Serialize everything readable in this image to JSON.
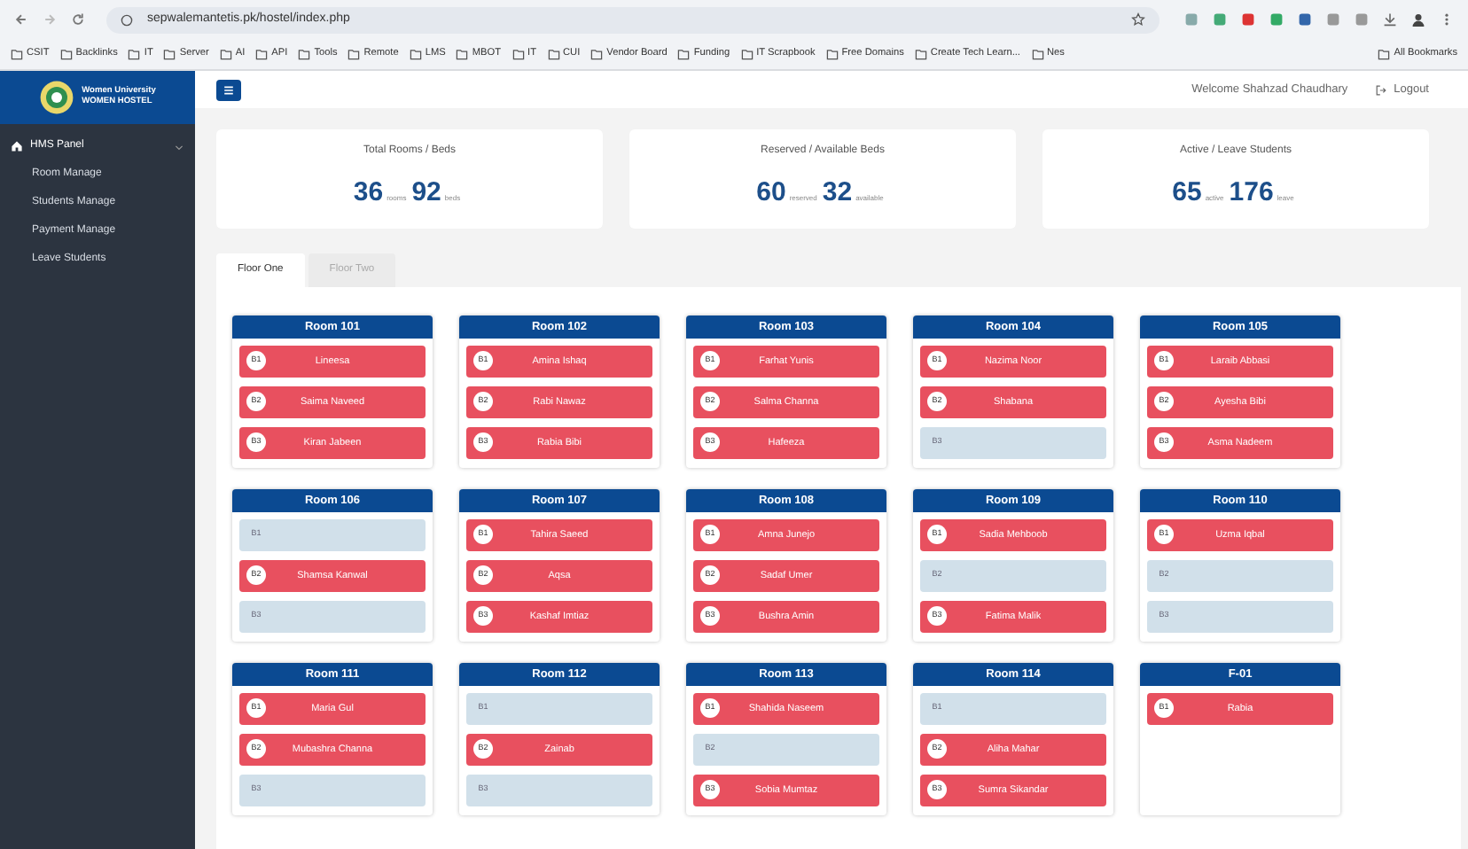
{
  "browser": {
    "url": "sepwalemantetis.pk/hostel/index.php",
    "bookmarks": [
      "CSIT",
      "Backlinks",
      "IT",
      "Server",
      "AI",
      "API",
      "Tools",
      "Remote",
      "LMS",
      "MBOT",
      "IT",
      "CUI",
      "Vendor Board",
      "Funding",
      "IT Scrapbook",
      "Free Domains",
      "Create Tech Learn...",
      "Nes"
    ],
    "all_bookmarks": "All Bookmarks"
  },
  "sidebar": {
    "logo_lines": [
      "Women University",
      "WOMEN HOSTEL"
    ],
    "panel": "HMS Panel",
    "expanded": true,
    "items": [
      "Room Manage",
      "Students Manage",
      "Payment Manage",
      "Leave Students"
    ]
  },
  "header": {
    "welcome": "Welcome Shahzad Chaudhary",
    "logout": "Logout"
  },
  "stats": [
    {
      "title": "Total Rooms / Beds",
      "v1": "36",
      "u1": "rooms",
      "v2": "92",
      "u2": "beds"
    },
    {
      "title": "Reserved / Available Beds",
      "v1": "60",
      "u1": "reserved",
      "v2": "32",
      "u2": "available"
    },
    {
      "title": "Active / Leave Students",
      "v1": "65",
      "u1": "active",
      "v2": "176",
      "u2": "leave"
    }
  ],
  "tabs": [
    {
      "label": "Floor One",
      "selected": true
    },
    {
      "label": "Floor Two",
      "selected": false
    }
  ],
  "rooms": [
    {
      "title": "Room 101",
      "beds": [
        {
          "number": "B1",
          "occupied": true,
          "student": "Lineesa"
        },
        {
          "number": "B2",
          "occupied": true,
          "student": "Saima Naveed"
        },
        {
          "number": "B3",
          "occupied": true,
          "student": "Kiran Jabeen"
        }
      ]
    },
    {
      "title": "Room 102",
      "beds": [
        {
          "number": "B1",
          "occupied": true,
          "student": "Amina Ishaq"
        },
        {
          "number": "B2",
          "occupied": true,
          "student": "Rabi Nawaz"
        },
        {
          "number": "B3",
          "occupied": true,
          "student": "Rabia Bibi"
        }
      ]
    },
    {
      "title": "Room 103",
      "beds": [
        {
          "number": "B1",
          "occupied": true,
          "student": "Farhat Yunis"
        },
        {
          "number": "B2",
          "occupied": true,
          "student": "Salma Channa"
        },
        {
          "number": "B3",
          "occupied": true,
          "student": "Hafeeza"
        }
      ]
    },
    {
      "title": "Room 104",
      "beds": [
        {
          "number": "B1",
          "occupied": true,
          "student": "Nazima Noor"
        },
        {
          "number": "B2",
          "occupied": true,
          "student": "Shabana"
        },
        {
          "number": "B3",
          "occupied": false
        }
      ]
    },
    {
      "title": "Room 105",
      "beds": [
        {
          "number": "B1",
          "occupied": true,
          "student": "Laraib Abbasi"
        },
        {
          "number": "B2",
          "occupied": true,
          "student": "Ayesha Bibi"
        },
        {
          "number": "B3",
          "occupied": true,
          "student": "Asma Nadeem"
        }
      ]
    },
    {
      "title": "Room 106",
      "beds": [
        {
          "number": "B1",
          "occupied": false
        },
        {
          "number": "B2",
          "occupied": true,
          "student": "Shamsa Kanwal"
        },
        {
          "number": "B3",
          "occupied": false
        }
      ]
    },
    {
      "title": "Room 107",
      "beds": [
        {
          "number": "B1",
          "occupied": true,
          "student": "Tahira Saeed"
        },
        {
          "number": "B2",
          "occupied": true,
          "student": "Aqsa"
        },
        {
          "number": "B3",
          "occupied": true,
          "student": "Kashaf Imtiaz"
        }
      ]
    },
    {
      "title": "Room 108",
      "beds": [
        {
          "number": "B1",
          "occupied": true,
          "student": "Amna Junejo"
        },
        {
          "number": "B2",
          "occupied": true,
          "student": "Sadaf Umer"
        },
        {
          "number": "B3",
          "occupied": true,
          "student": "Bushra Amin"
        }
      ]
    },
    {
      "title": "Room 109",
      "beds": [
        {
          "number": "B1",
          "occupied": true,
          "student": "Sadia Mehboob"
        },
        {
          "number": "B2",
          "occupied": false
        },
        {
          "number": "B3",
          "occupied": true,
          "student": "Fatima Malik"
        }
      ]
    },
    {
      "title": "Room 110",
      "beds": [
        {
          "number": "B1",
          "occupied": true,
          "student": "Uzma Iqbal"
        },
        {
          "number": "B2",
          "occupied": false
        },
        {
          "number": "B3",
          "occupied": false
        }
      ]
    },
    {
      "title": "Room 111",
      "beds": [
        {
          "number": "B1",
          "occupied": true,
          "student": "Maria Gul"
        },
        {
          "number": "B2",
          "occupied": true,
          "student": "Mubashra Channa"
        },
        {
          "number": "B3",
          "occupied": false
        }
      ]
    },
    {
      "title": "Room 112",
      "beds": [
        {
          "number": "B1",
          "occupied": false
        },
        {
          "number": "B2",
          "occupied": true,
          "student": "Zainab"
        },
        {
          "number": "B3",
          "occupied": false
        }
      ]
    },
    {
      "title": "Room 113",
      "beds": [
        {
          "number": "B1",
          "occupied": true,
          "student": "Shahida Naseem"
        },
        {
          "number": "B2",
          "occupied": false
        },
        {
          "number": "B3",
          "occupied": true,
          "student": "Sobia Mumtaz"
        }
      ]
    },
    {
      "title": "Room 114",
      "beds": [
        {
          "number": "B1",
          "occupied": false
        },
        {
          "number": "B2",
          "occupied": true,
          "student": "Aliha Mahar"
        },
        {
          "number": "B3",
          "occupied": true,
          "student": "Sumra Sikandar"
        }
      ]
    },
    {
      "title": "F-01",
      "beds": [
        {
          "number": "B1",
          "occupied": true,
          "student": "Rabia"
        }
      ]
    }
  ]
}
